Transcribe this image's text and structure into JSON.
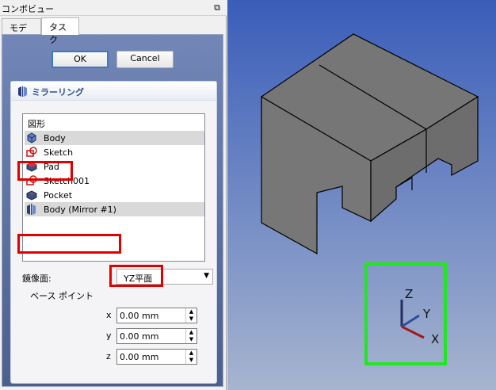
{
  "panel": {
    "title": "コンボビュー",
    "float_glyph": "⧉",
    "tabs": [
      "モデル",
      "タスク"
    ]
  },
  "buttons": {
    "ok": "OK",
    "cancel": "Cancel"
  },
  "mirror": {
    "title": "ミラーリング",
    "list_caption": "図形",
    "items": [
      {
        "label": "Body",
        "icon": "body-icon",
        "selected": true
      },
      {
        "label": "Sketch",
        "icon": "sketch-icon",
        "selected": false
      },
      {
        "label": "Pad",
        "icon": "pad-icon",
        "selected": false
      },
      {
        "label": "Sketch001",
        "icon": "sketch-icon",
        "selected": false
      },
      {
        "label": "Pocket",
        "icon": "pocket-icon",
        "selected": false
      },
      {
        "label": "Body (Mirror #1)",
        "icon": "mirror-icon",
        "selected": true
      }
    ],
    "plane_label": "鏡像面:",
    "plane_value": "YZ平面",
    "base_point_label": "ベース ポイント",
    "coords": [
      {
        "axis": "x",
        "value": "0.00 mm"
      },
      {
        "axis": "y",
        "value": "0.00 mm"
      },
      {
        "axis": "z",
        "value": "0.00 mm"
      }
    ]
  },
  "viewport": {
    "axis_labels": {
      "z": "Z",
      "y": "Y",
      "x": "X"
    },
    "colors": {
      "highlight_red": "#e00000",
      "highlight_green": "#22e622",
      "model_gray": "#7f7f7f"
    }
  }
}
